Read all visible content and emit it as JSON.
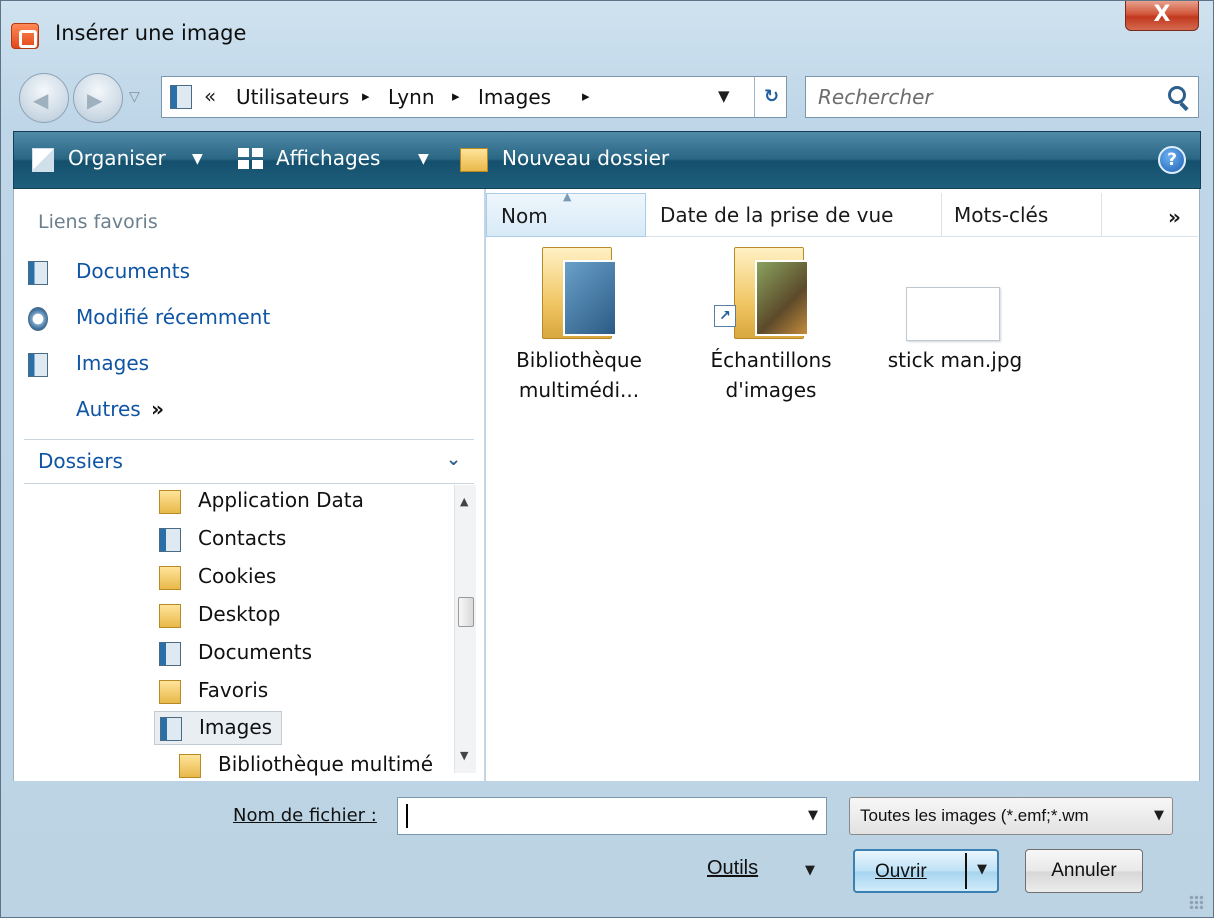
{
  "window": {
    "title": "Insérer une image",
    "close_label": "X"
  },
  "address": {
    "chevron": "«",
    "breadcrumbs": [
      "Utilisateurs",
      "Lynn",
      "Images"
    ],
    "separator": "▸"
  },
  "search": {
    "placeholder": "Rechercher"
  },
  "toolbar": {
    "organize": "Organiser",
    "views": "Affichages",
    "new_folder": "Nouveau dossier",
    "help": "?"
  },
  "favorites": {
    "header": "Liens favoris",
    "items": [
      {
        "label": "Documents",
        "icon": "documents-icon"
      },
      {
        "label": "Modifié récemment",
        "icon": "recent-icon"
      },
      {
        "label": "Images",
        "icon": "pictures-icon"
      }
    ],
    "more": "Autres",
    "more_glyph": "»"
  },
  "folders": {
    "header": "Dossiers",
    "items": [
      {
        "label": "Application Data",
        "icon": "shortcut-folder-icon"
      },
      {
        "label": "Contacts",
        "icon": "contacts-icon"
      },
      {
        "label": "Cookies",
        "icon": "shortcut-folder-icon"
      },
      {
        "label": "Desktop",
        "icon": "folder-icon"
      },
      {
        "label": "Documents",
        "icon": "documents-icon"
      },
      {
        "label": "Favoris",
        "icon": "favorites-icon"
      },
      {
        "label": "Images",
        "icon": "pictures-icon",
        "selected": true
      },
      {
        "label": "Bibliothèque multimé",
        "icon": "folder-icon"
      }
    ]
  },
  "columns": {
    "name": "Nom",
    "date": "Date de la prise de vue",
    "tags": "Mots-clés",
    "more": "»"
  },
  "files": [
    {
      "line1": "Bibliothèque",
      "line2": "multimédi...",
      "type": "folder"
    },
    {
      "line1": "Échantillons",
      "line2": "d'images",
      "type": "shortcut-folder"
    },
    {
      "line1": "stick man.jpg",
      "line2": "",
      "type": "image"
    }
  ],
  "bottom": {
    "filename_label": "Nom de fichier :",
    "filename_value": "",
    "filetype": "Toutes les images (*.emf;*.wm",
    "tools": "Outils",
    "open": "Ouvrir",
    "cancel": "Annuler"
  },
  "colors": {
    "link": "#0f55a4",
    "toolbar": "#1f5f7c",
    "accent_button": "#bfe2f6"
  }
}
